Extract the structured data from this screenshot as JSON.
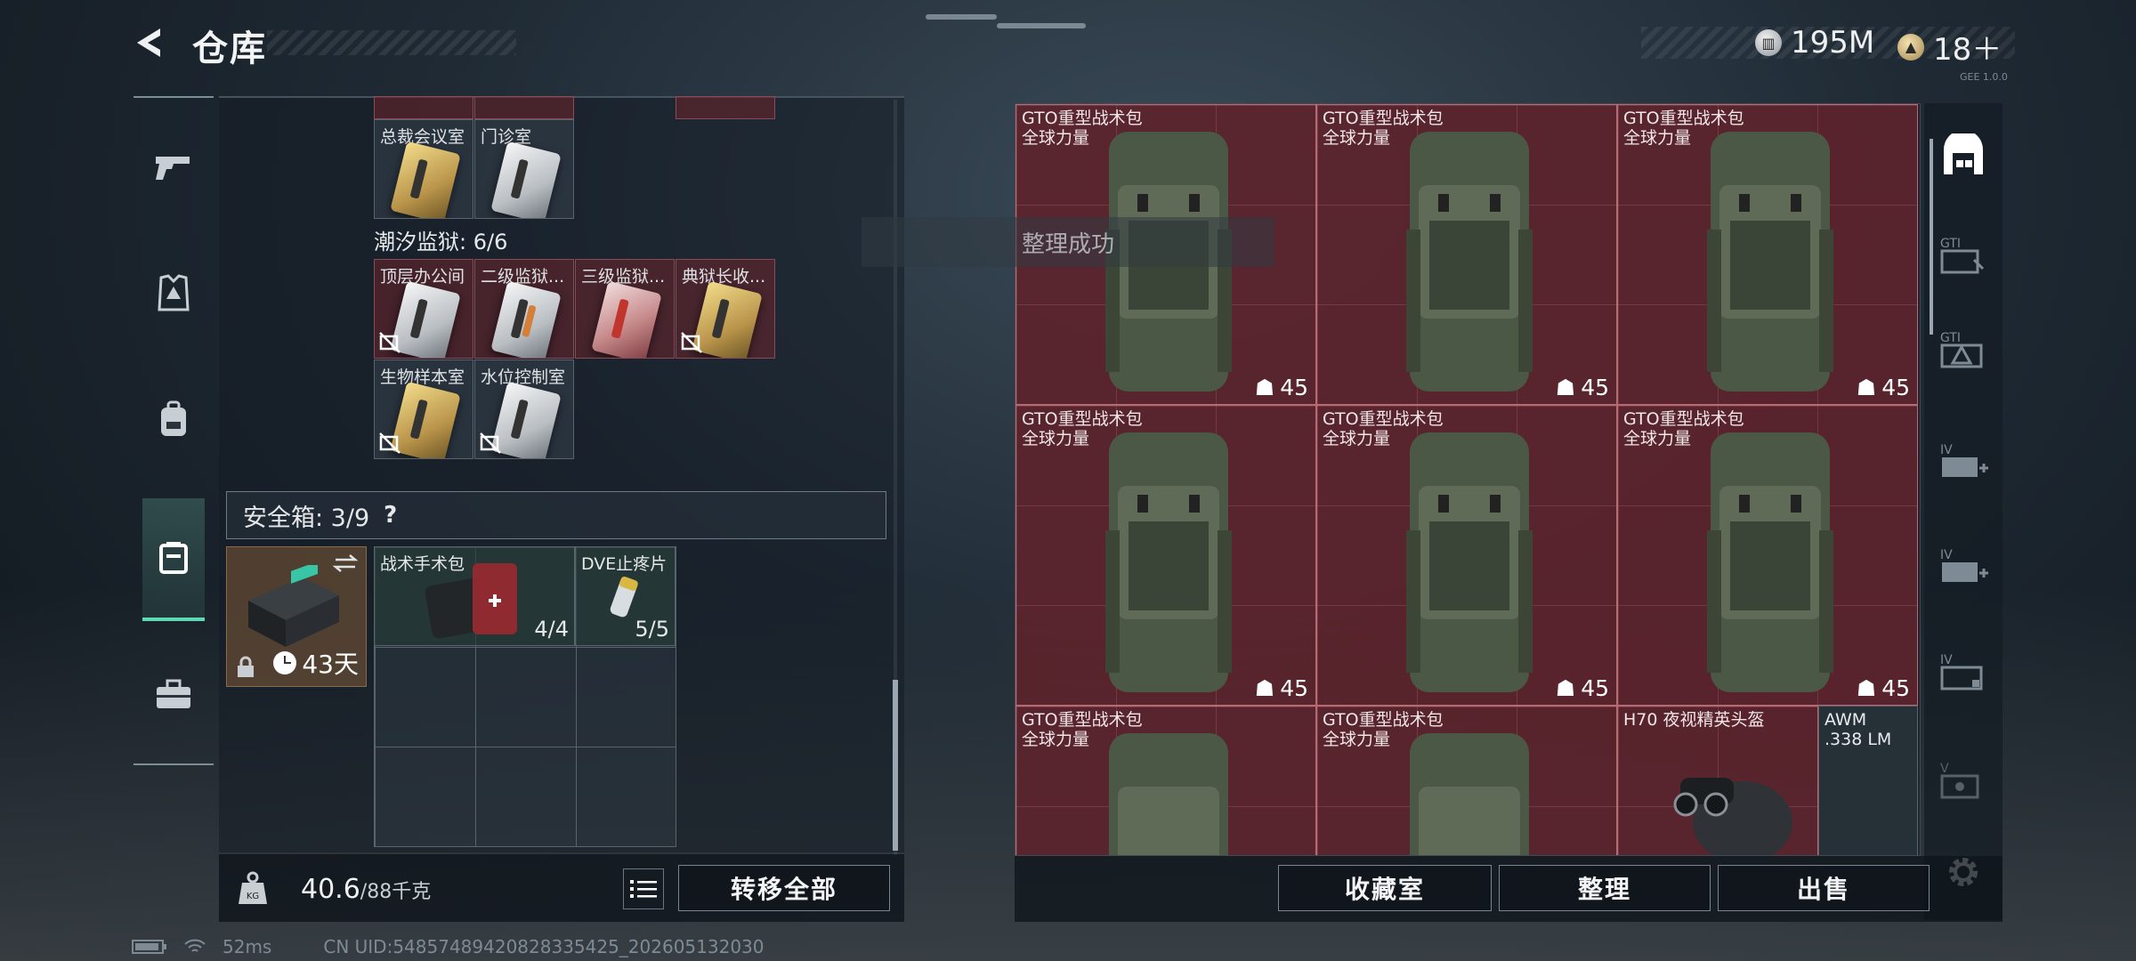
{
  "header": {
    "title": "仓库",
    "currency_1": "195M",
    "currency_2": "18＋",
    "version": "GEE 1.0.0"
  },
  "left_rail": [
    "weapons-tab",
    "armor-tab",
    "backpack-tab",
    "safebox-tab",
    "toolbox-tab"
  ],
  "keys_top": [
    {
      "label": "总裁会议室",
      "card": "gold"
    },
    {
      "label": "门诊室",
      "card": "white"
    }
  ],
  "tidal_prison": {
    "label": "潮汐监狱: 6/6",
    "cards": [
      {
        "label": "顶层办公间",
        "card": "white"
      },
      {
        "label": "二级监狱...",
        "card": "white"
      },
      {
        "label": "三级监狱...",
        "card": "red"
      },
      {
        "label": "典狱长收...",
        "card": "gold"
      },
      {
        "label": "生物样本室",
        "card": "gold"
      },
      {
        "label": "水位控制室",
        "card": "white"
      }
    ]
  },
  "safebox": {
    "label": "安全箱: 3/9",
    "help": "?",
    "days": "43天",
    "items": [
      {
        "label": "战术手术包",
        "count": "4/4"
      },
      {
        "label": "DVE止疼片",
        "count": "5/5"
      }
    ]
  },
  "weight": {
    "current": "40.6",
    "max": "/88千克"
  },
  "buttons": {
    "transfer_all": "转移全部",
    "collection": "收藏室",
    "organize": "整理",
    "sell": "出售"
  },
  "toast": "整理成功",
  "stash": {
    "bag_name": "GTO重型战术包",
    "bag_brand": "全球力量",
    "bag_durability": "45",
    "helmet": "H70 夜视精英头盔",
    "ammo_line1": "AWM",
    "ammo_line2": ".338 LM"
  },
  "right_tabs": [
    "stash-main-tab",
    "gti-tab-1",
    "gti-tab-2",
    "iv-tab-1",
    "iv-tab-2",
    "iv-tab-3",
    "v-tab"
  ],
  "footer": {
    "ping": "52ms",
    "uid": "CN UID:5485748942082833542​5_202605132030"
  },
  "colors": {
    "accent": "#5fd8b4",
    "stash_red": "#6e2530",
    "panel": "#141c24"
  }
}
